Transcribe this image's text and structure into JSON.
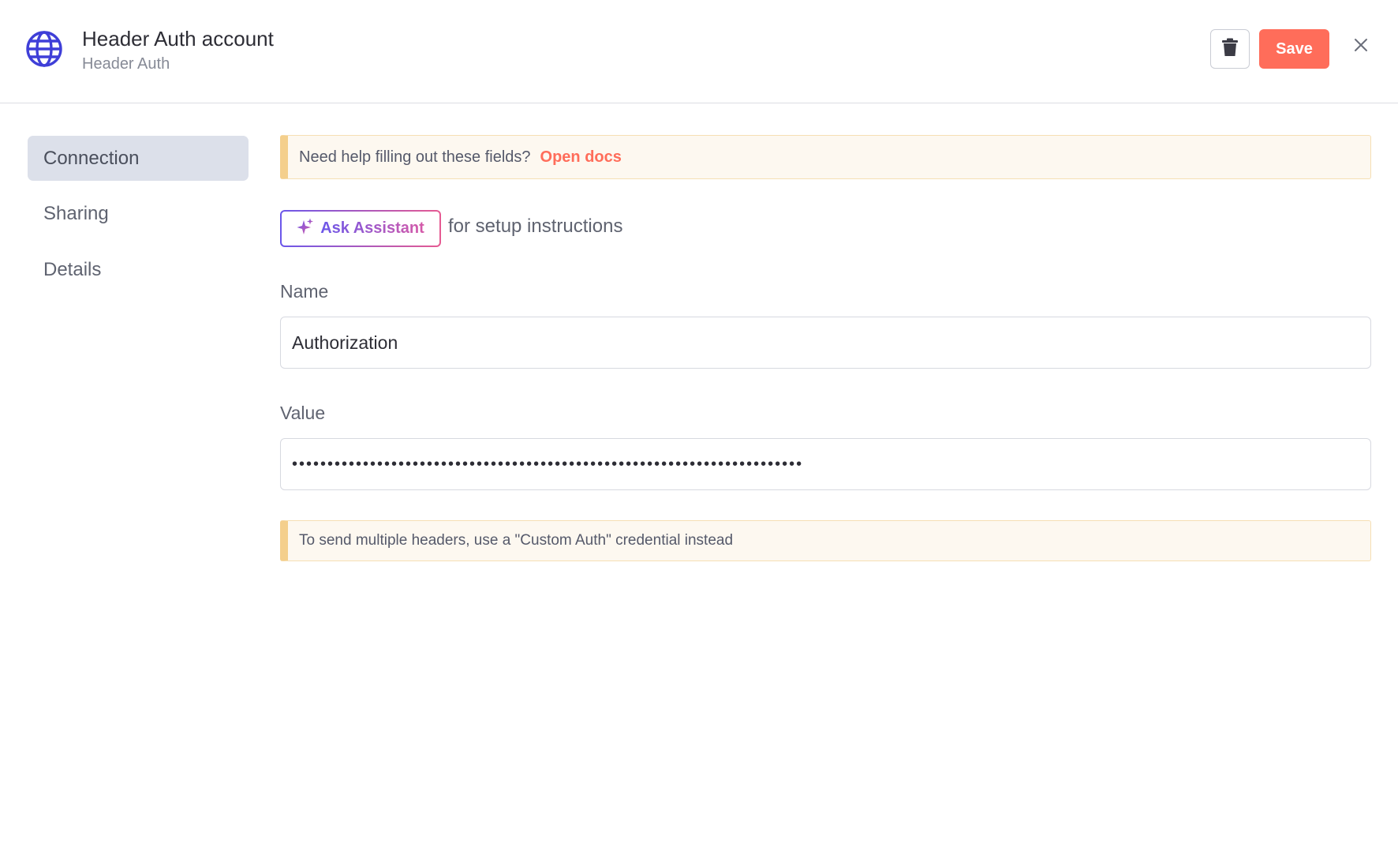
{
  "header": {
    "title": "Header Auth account",
    "subtitle": "Header Auth",
    "icon": "globe-icon",
    "save_label": "Save",
    "delete_icon": "trash-icon",
    "close_icon": "close-icon"
  },
  "sidebar": {
    "items": [
      {
        "label": "Connection",
        "active": true
      },
      {
        "label": "Sharing",
        "active": false
      },
      {
        "label": "Details",
        "active": false
      }
    ]
  },
  "help": {
    "text": "Need help filling out these fields?",
    "link": "Open docs"
  },
  "assistant": {
    "button_label": "Ask Assistant",
    "suffix": "for setup instructions",
    "icon": "sparkle-icon"
  },
  "fields": {
    "name": {
      "label": "Name",
      "value": "Authorization"
    },
    "value": {
      "label": "Value",
      "masked_value": "••••••••••••••••••••••••••••••••••••••••••••••••••••••••••••••••••••••••"
    }
  },
  "notice": {
    "text": "To send multiple headers, use a \"Custom Auth\" credential instead"
  },
  "colors": {
    "accent": "#ff6d5a",
    "globe": "#3f3fd8",
    "callout_border": "#f4cf8c",
    "callout_bg": "#fdf8f0",
    "nav_active_bg": "#dce0ea"
  }
}
